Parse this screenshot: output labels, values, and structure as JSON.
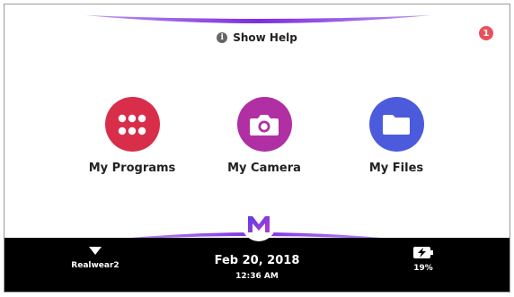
{
  "help": {
    "label": "Show Help",
    "icon": "info-icon"
  },
  "notifications": {
    "count": "1",
    "color": "#e9515a"
  },
  "apps": [
    {
      "label": "My Programs",
      "icon": "grid-dots-icon",
      "color": "#d92e4a"
    },
    {
      "label": "My Camera",
      "icon": "camera-icon",
      "color": "#b02fa3"
    },
    {
      "label": "My Files",
      "icon": "folder-icon",
      "color": "#4b5bdc"
    }
  ],
  "status": {
    "network": "Realwear2",
    "date": "Feb 20, 2018",
    "time": "12:36 AM",
    "battery": "19%"
  },
  "accent": "#7b2ee0"
}
